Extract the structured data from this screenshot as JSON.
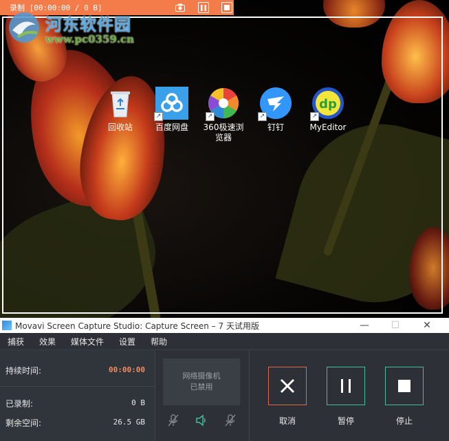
{
  "recorder": {
    "status": "录制 [00:00:00 / 0 B]",
    "buttons": [
      "camera-icon",
      "pause-icon",
      "stop-icon"
    ]
  },
  "watermark": {
    "title": "河东软件园",
    "url": "www.pc0359.cn"
  },
  "desktop": {
    "icons": [
      {
        "label": "回收站",
        "icon": "recycle-bin-icon"
      },
      {
        "label": "百度网盘",
        "icon": "baidu-netdisk-icon"
      },
      {
        "label": "360极速浏览器",
        "icon": "360-browser-icon"
      },
      {
        "label": "钉钉",
        "icon": "dingtalk-icon"
      },
      {
        "label": "MyEditor",
        "icon": "myeditor-icon"
      }
    ]
  },
  "window": {
    "title": "Movavi Screen Capture Studio: Capture Screen – 7 天试用版",
    "controls": [
      "minimize-icon",
      "maximize-icon",
      "close-icon"
    ]
  },
  "menu": [
    "捕获",
    "效果",
    "媒体文件",
    "设置",
    "帮助"
  ],
  "stats": {
    "duration_label": "持续时间:",
    "duration_value": "00:00:00",
    "recorded_label": "已录制:",
    "recorded_value": "0 B",
    "space_label": "剩余空间:",
    "space_value": "26.5 GB"
  },
  "webcam": {
    "line1": "网络摄像机",
    "line2": "已禁用"
  },
  "audio": [
    "microphone-muted-icon",
    "speaker-icon",
    "microphone-off-icon"
  ],
  "controls": {
    "cancel": "取消",
    "pause": "暂停",
    "stop": "停止"
  },
  "colors": {
    "recorder_bar": "#f47c4a",
    "duration_accent": "#f08a5d",
    "cancel_border": "#e06a50",
    "pause_border": "#3fc0a0",
    "stop_border": "#3fc0a0",
    "speaker_accent": "#3fc0a0"
  }
}
